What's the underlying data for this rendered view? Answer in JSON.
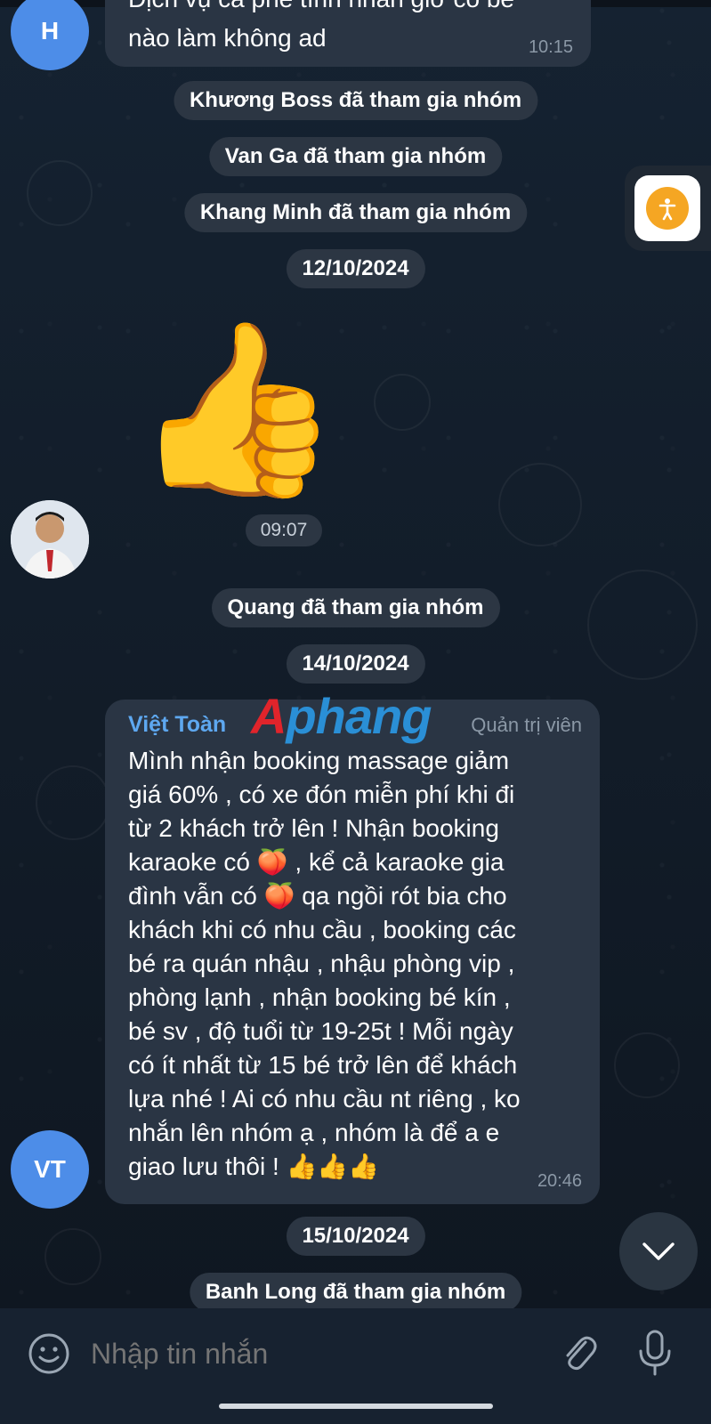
{
  "messages": {
    "first": {
      "avatar_initial": "H",
      "text_partial": "Dịch vụ cà phê tình nhân giờ có bé",
      "text_second": "nào làm không ad",
      "time": "10:15"
    },
    "system_1": "Khương Boss đã tham gia nhóm",
    "system_2": "Van Ga đã tham gia nhóm",
    "system_3": "Khang Minh đã tham gia nhóm",
    "date_1": "12/10/2024",
    "sticker": {
      "emoji": "👍",
      "time": "09:07"
    },
    "system_4": "Quang đã tham gia nhóm",
    "date_2": "14/10/2024",
    "main": {
      "avatar_initial": "VT",
      "sender": "Việt Toàn",
      "role": "Quản trị viên",
      "lines": [
        "Mình nhận booking massage giảm",
        "giá 60% , có xe đón miễn phí khi đi",
        "từ 2 khách trở lên ! Nhận booking",
        "karaoke có 🍑 , kể cả karaoke gia",
        "đình vẫn có 🍑 qa ngồi rót bia cho",
        "khách khi có nhu cầu , booking các",
        "bé ra quán nhậu , nhậu phòng vip ,",
        "phòng lạnh ,  nhận booking bé kín ,",
        "bé sv , độ tuổi từ 19-25t ! Mỗi ngày",
        "có ít nhất từ 15 bé trở lên để khách",
        "lựa nhé ! Ai có nhu cầu nt riêng , ko",
        "nhắn lên nhóm ạ , nhóm là để a e",
        "giao lưu thôi ! 👍👍👍"
      ],
      "time": "20:46"
    },
    "date_3": "15/10/2024",
    "system_5": "Banh Long đã tham gia nhóm"
  },
  "watermark": "Aphang",
  "input": {
    "placeholder": "Nhập tin nhắn"
  },
  "colors": {
    "accent_blue": "#4d8de8",
    "sender_name": "#5ea8f0",
    "bubble": "#2a3544",
    "watermark_red": "#e0242b",
    "watermark_blue": "#2a8fd6"
  }
}
